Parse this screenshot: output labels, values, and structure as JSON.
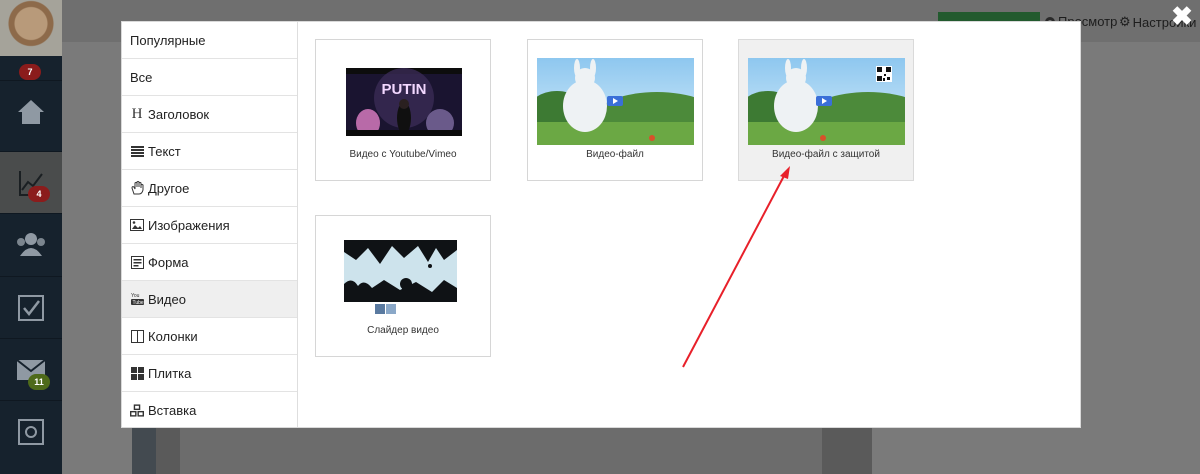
{
  "app": {
    "badges": {
      "profile": "7",
      "analytics": "4",
      "mail": "11"
    },
    "top_links": {
      "preview": "Просмотр",
      "settings": "Настройки"
    }
  },
  "modal": {
    "menu": [
      {
        "label": "Популярные",
        "icon": "none"
      },
      {
        "label": "Все",
        "icon": "none"
      },
      {
        "label": "Заголовок",
        "icon": "heading-icon"
      },
      {
        "label": "Текст",
        "icon": "text-lines-icon"
      },
      {
        "label": "Другое",
        "icon": "hand-icon"
      },
      {
        "label": "Изображения",
        "icon": "image-icon"
      },
      {
        "label": "Форма",
        "icon": "form-icon"
      },
      {
        "label": "Видео",
        "icon": "youtube-icon",
        "active": true
      },
      {
        "label": "Колонки",
        "icon": "columns-icon"
      },
      {
        "label": "Плитка",
        "icon": "tiles-icon"
      },
      {
        "label": "Вставка",
        "icon": "cubes-icon"
      }
    ],
    "cards": [
      {
        "caption": "Видео с Youtube/Vimeo",
        "thumb_text": "PUTIN"
      },
      {
        "caption": "Видео-файл"
      },
      {
        "caption": "Видео-файл с защитой"
      },
      {
        "caption": "Слайдер видео"
      }
    ]
  },
  "colors": {
    "annotation_arrow": "#e8202a"
  }
}
